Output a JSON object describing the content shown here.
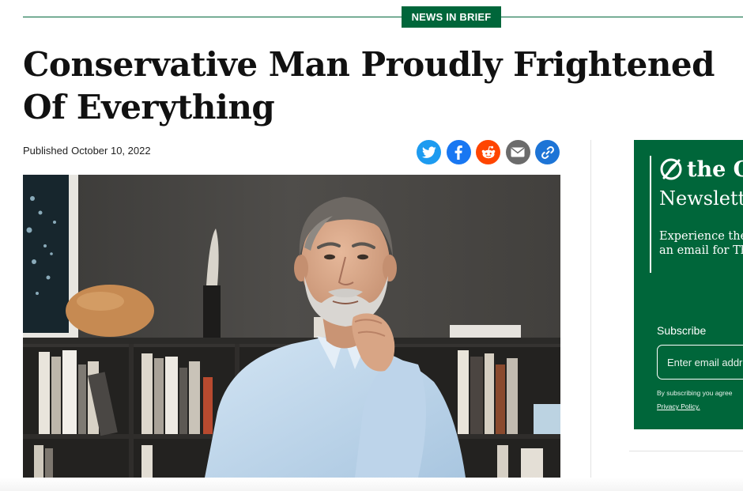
{
  "section": {
    "tag": "NEWS IN BRIEF"
  },
  "article": {
    "headline": "Conservative Man Proudly Frightened Of Everything",
    "published_label": "Published",
    "published_date": "October 10, 2022"
  },
  "share": {
    "buttons": [
      {
        "icon": "twitter-icon",
        "color": "#1d9bf0"
      },
      {
        "icon": "facebook-icon",
        "color": "#1877f2"
      },
      {
        "icon": "reddit-icon",
        "color": "#ff4500"
      },
      {
        "icon": "email-icon",
        "color": "#6b6b6b"
      },
      {
        "icon": "link-icon",
        "color": "#1d74d6"
      }
    ]
  },
  "newsletter": {
    "logo_text": "the O",
    "title": "Newsletter",
    "description": "Experience the joy of receiving an email for The Onion",
    "subscribe_label": "Subscribe",
    "email_placeholder": "Enter email address",
    "fine_print": "By subscribing you agree",
    "privacy_link": "Privacy Policy."
  },
  "colors": {
    "brand_green": "#00663a",
    "text": "#111111"
  }
}
